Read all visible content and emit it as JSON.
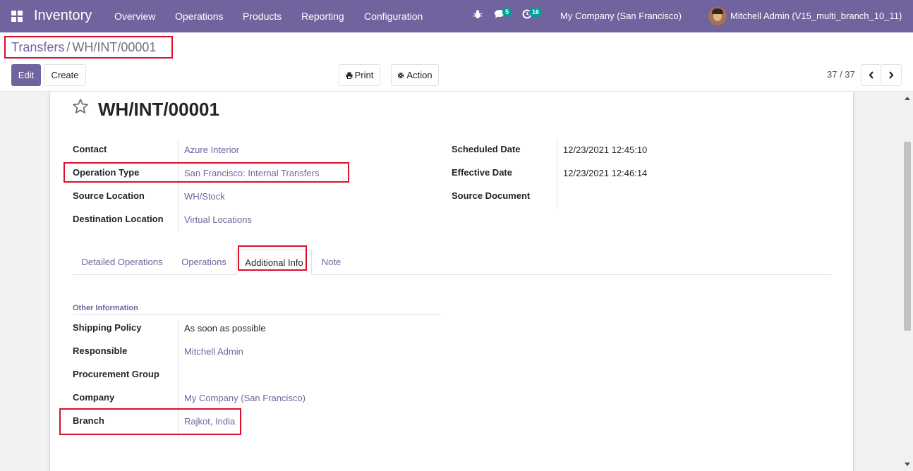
{
  "navbar": {
    "brand": "Inventory",
    "menu": [
      "Overview",
      "Operations",
      "Products",
      "Reporting",
      "Configuration"
    ],
    "messages_count": "5",
    "activities_count": "16",
    "company": "My Company (San Francisco)",
    "user": "Mitchell Admin (V15_multi_branch_10_11)"
  },
  "breadcrumb": {
    "parent": "Transfers",
    "separator": "/",
    "current": "WH/INT/00001"
  },
  "toolbar": {
    "edit": "Edit",
    "create": "Create",
    "print": "Print",
    "action": "Action"
  },
  "pager": {
    "text": "37 / 37"
  },
  "record": {
    "name": "WH/INT/00001",
    "left_fields": [
      {
        "label": "Contact",
        "value": "Azure Interior"
      },
      {
        "label": "Operation Type",
        "value": "San Francisco: Internal Transfers"
      },
      {
        "label": "Source Location",
        "value": "WH/Stock"
      },
      {
        "label": "Destination Location",
        "value": "Virtual Locations"
      }
    ],
    "right_fields": [
      {
        "label": "Scheduled Date",
        "value": "12/23/2021 12:45:10"
      },
      {
        "label": "Effective Date",
        "value": "12/23/2021 12:46:14"
      },
      {
        "label": "Source Document",
        "value": ""
      }
    ]
  },
  "tabs": [
    "Detailed Operations",
    "Operations",
    "Additional Info",
    "Note"
  ],
  "active_tab": "Additional Info",
  "other_info": {
    "title": "Other Information",
    "fields": [
      {
        "label": "Shipping Policy",
        "value": "As soon as possible"
      },
      {
        "label": "Responsible",
        "value": "Mitchell Admin"
      },
      {
        "label": "Procurement Group",
        "value": ""
      },
      {
        "label": "Company",
        "value": "My Company (San Francisco)"
      },
      {
        "label": "Branch",
        "value": "Rajkot, India"
      }
    ]
  },
  "colors": {
    "brand": "#71639e",
    "highlight": "#d9112b",
    "badge": "#00a09d"
  }
}
